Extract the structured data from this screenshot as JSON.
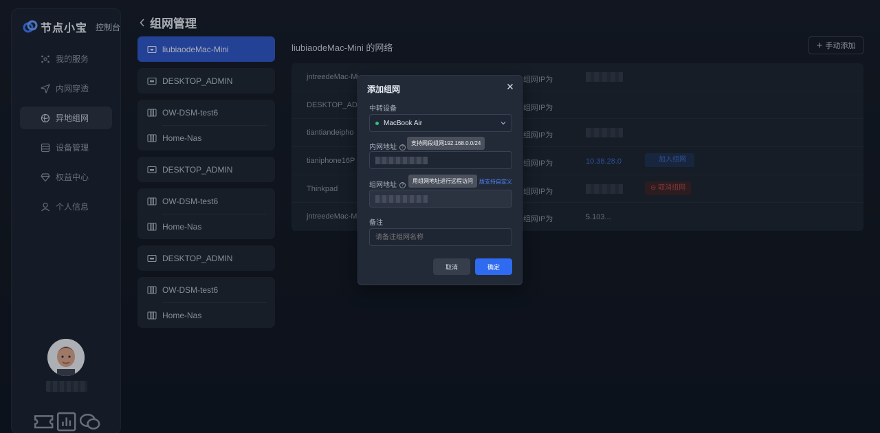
{
  "app": {
    "name": "节点小宝",
    "console": "控制台"
  },
  "nav": [
    {
      "label": "我的服务",
      "icon": "services-icon"
    },
    {
      "label": "内网穿透",
      "icon": "send-icon"
    },
    {
      "label": "异地组网",
      "icon": "network-icon",
      "active": true
    },
    {
      "label": "设备管理",
      "icon": "device-icon"
    },
    {
      "label": "权益中心",
      "icon": "diamond-icon"
    },
    {
      "label": "个人信息",
      "icon": "user-icon"
    }
  ],
  "page": {
    "title": "组网管理"
  },
  "groups": [
    {
      "devices": [
        {
          "name": "liubiaodeMac-Mini",
          "type": "mac",
          "selected": true
        }
      ]
    },
    {
      "devices": [
        {
          "name": "DESKTOP_ADMIN",
          "type": "pc"
        }
      ]
    },
    {
      "devices": [
        {
          "name": "OW-DSM-test6",
          "type": "nas"
        },
        {
          "name": "Home-Nas",
          "type": "nas"
        }
      ]
    },
    {
      "devices": [
        {
          "name": "DESKTOP_ADMIN",
          "type": "pc"
        }
      ]
    },
    {
      "devices": [
        {
          "name": "OW-DSM-test6",
          "type": "nas"
        },
        {
          "name": "Home-Nas",
          "type": "nas"
        }
      ]
    },
    {
      "devices": [
        {
          "name": "DESKTOP_ADMIN",
          "type": "pc"
        }
      ]
    },
    {
      "devices": [
        {
          "name": "OW-DSM-test6",
          "type": "nas"
        },
        {
          "name": "Home-Nas",
          "type": "nas"
        }
      ]
    }
  ],
  "main": {
    "network_title": "liubiaodeMac-Mini 的网络",
    "add_label": "手动添加",
    "rows": [
      {
        "name": "jntreedeMac-Mi",
        "ip_label": "组网IP为"
      },
      {
        "name": "DESKTOP_ADM",
        "ip_label": "组网IP为"
      },
      {
        "name": "tiantiandeipho",
        "ip_label": "组网IP为"
      },
      {
        "name": "tianiphone16P",
        "ip_label": "组网IP为",
        "ip_value": "10.38.28.0",
        "action": "加入组网"
      },
      {
        "name": "Thinkpad",
        "ip_label": "组网IP为",
        "action": "取消组网"
      },
      {
        "name": "jntreedeMac-M",
        "ip_label": "组网IP为",
        "ip_value": "5.103..."
      }
    ]
  },
  "dialog": {
    "title": "添加组网",
    "relay_label": "中转设备",
    "relay_value": "MacBook Air",
    "lan_label": "内网地址",
    "lan_tooltip": "支持网段组网192.168.0.0/24",
    "net_label": "组网地址",
    "net_tooltip": "用组网地址进行远程访问",
    "custom_link": "版支持自定义",
    "remark_label": "备注",
    "remark_placeholder": "请备注组网名称",
    "cancel": "取消",
    "ok": "确定"
  },
  "colors": {
    "accent": "#2f6bf0",
    "selected": "#2e56c9",
    "danger": "#b44a4a",
    "online": "#2ec27e"
  }
}
